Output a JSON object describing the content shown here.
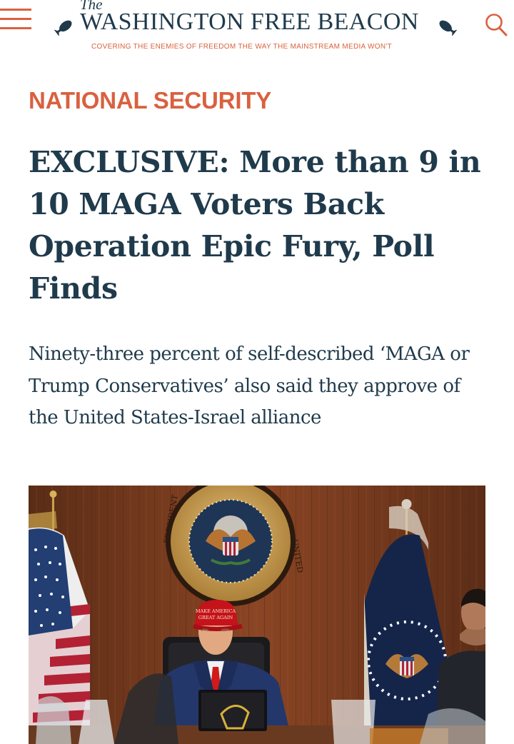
{
  "header": {
    "menu_icon": "hamburger-menu-icon",
    "logo": {
      "the": "The",
      "name": "WASHINGTON FREE BEACON",
      "tagline": "COVERING THE ENEMIES OF FREEDOM THE WAY THE MAINSTREAM MEDIA WON'T"
    },
    "search_icon": "search-icon"
  },
  "article": {
    "category": "NATIONAL SECURITY",
    "headline": "EXCLUSIVE: More than 9 in 10 MAGA Voters Back Operation Epic Fury, Poll Finds",
    "dek": "Ninety-three percent of self-described ‘MAGA or Trump Conservatives’ also said they approve of the United States-Israel alliance",
    "photo": {
      "seal_text": "SEAL OF THE PRESIDENT OF THE UNITED STATES",
      "hat_text": "MAKE AMERICA GREAT AGAIN"
    }
  },
  "colors": {
    "accent": "#d9613f",
    "text": "#1f3a4b",
    "background": "#ffffff"
  }
}
